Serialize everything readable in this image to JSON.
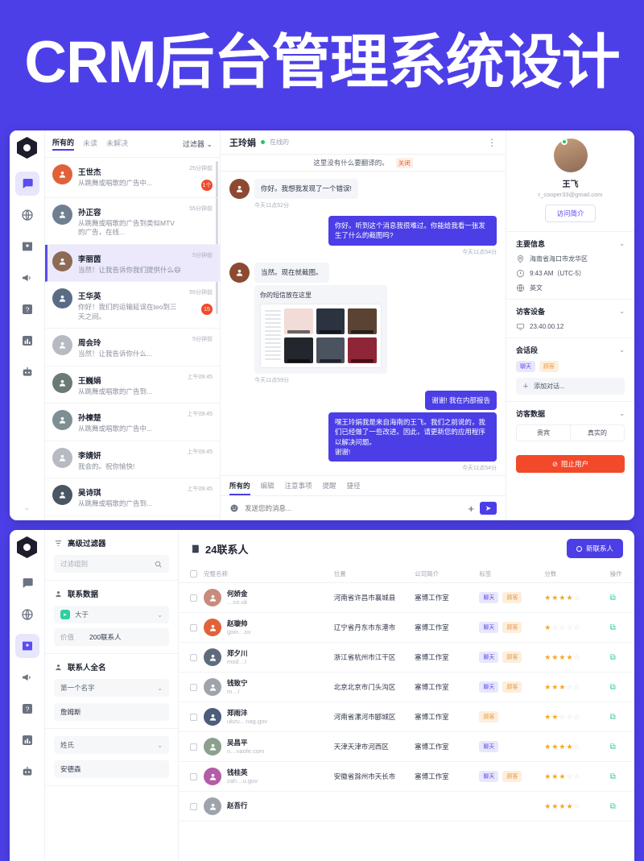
{
  "banner": {
    "title": "CRM后台管理系统设计"
  },
  "colors": {
    "brand": "#4d3fe8",
    "accent": "#4b3ee6",
    "danger": "#f3492b",
    "success": "#2ecfa0",
    "star": "#f5a623"
  },
  "inbox": {
    "rail": [
      {
        "name": "logo",
        "icon": "hexagon-logo"
      },
      {
        "name": "chat",
        "icon": "chat-icon",
        "active": true
      },
      {
        "name": "globe",
        "icon": "globe-icon",
        "active": false
      },
      {
        "name": "contacts",
        "icon": "contact-card-icon",
        "active": false
      },
      {
        "name": "campaign",
        "icon": "megaphone-icon",
        "active": false
      },
      {
        "name": "help",
        "icon": "question-icon",
        "active": false
      },
      {
        "name": "reports",
        "icon": "bar-chart-icon",
        "active": false
      },
      {
        "name": "bot",
        "icon": "robot-icon",
        "active": false
      }
    ],
    "tabs": [
      {
        "label": "所有的",
        "active": true
      },
      {
        "label": "未读",
        "active": false
      },
      {
        "label": "未解决",
        "active": false
      }
    ],
    "filter_label": "过滤器",
    "conversations": [
      {
        "name": "王世杰",
        "snippet": "从跳舞或唱歌的广告中...",
        "time": "25分钟前",
        "badge": "1个",
        "active": false,
        "avatar": "#e0613a"
      },
      {
        "name": "孙正容",
        "snippet": "从跳舞或唱歌的广告到类似MTV的广告，在线...",
        "time": "55分钟前",
        "badge": "",
        "active": false,
        "avatar": "#6f7f91"
      },
      {
        "name": "李丽茵",
        "snippet": "当然！让我告诉你我们提供什么😄",
        "time": "5分钟前",
        "badge": "",
        "active": true,
        "avatar": "#8d6a55"
      },
      {
        "name": "王华英",
        "snippet": "你好！我们的运输延误在teo到三天之间。",
        "time": "55分钟前",
        "badge": "15",
        "active": false,
        "avatar": "#5a6b86"
      },
      {
        "name": "周会玲",
        "snippet": "当然！让我告诉你什么...",
        "time": "5分钟前",
        "badge": "",
        "active": false,
        "avatar": "#b6bac2"
      },
      {
        "name": "王巍娟",
        "snippet": "从跳舞或唱歌的广告到...",
        "time": "上午09:45",
        "badge": "",
        "active": false,
        "avatar": "#6b7b74"
      },
      {
        "name": "孙楝楚",
        "snippet": "从跳舞或唱歌的广告中...",
        "time": "上午09:45",
        "badge": "",
        "active": false,
        "avatar": "#7e8f93"
      },
      {
        "name": "李婧妍",
        "snippet": "我会的。祝你愉快!",
        "time": "上午09:45",
        "badge": "",
        "active": false,
        "avatar": "#b6bac2"
      },
      {
        "name": "吴诗琪",
        "snippet": "从跳舞或唱歌的广告到...",
        "time": "上午09:45",
        "badge": "",
        "active": false,
        "avatar": "#4a5763"
      }
    ],
    "chat": {
      "title": "王玲娟",
      "status": "在线的",
      "notice_text": "这里没有什么要翻译的。",
      "notice_close": "关闭",
      "messages": [
        {
          "dir": "in",
          "text": "你好。我想我发现了一个错误!",
          "time": "今天11点52分"
        },
        {
          "dir": "out",
          "text": "你好。听到这个消息我很难过。你能给我看一张发生了什么的截图吗?",
          "time": "今天11点54分"
        },
        {
          "dir": "in",
          "text": "当然。现在就截图。",
          "time": ""
        }
      ],
      "attachment": {
        "title": "你的短信放在这里",
        "time": "今天11点59分"
      },
      "messages_tail": [
        {
          "dir": "out",
          "text": "谢谢! 我在内部报告",
          "time": ""
        },
        {
          "dir": "out",
          "text": "嘿王玲娟我是来自海南的王飞。我们之前说的，我们已经做了一些改进。因此，请更新您的应用程序以解决问题。\n谢谢!",
          "time": "今天11点54分"
        }
      ],
      "composer_tabs": [
        {
          "label": "所有的",
          "active": true
        },
        {
          "label": "编辑",
          "active": false
        },
        {
          "label": "注意事项",
          "active": false
        },
        {
          "label": "提醒",
          "active": false
        },
        {
          "label": "捷径",
          "active": false
        }
      ],
      "composer_placeholder": "发送您的消息..."
    },
    "profile": {
      "name": "王飞",
      "email": "r_cooper33@gmail.com",
      "cta": "访问简介",
      "sections": [
        {
          "title": "主要信息",
          "rows": [
            {
              "icon": "location-pin-icon",
              "text": "海南省海口市龙华区"
            },
            {
              "icon": "clock-icon",
              "text": "9:43 AM（UTC-5）"
            },
            {
              "icon": "globe-icon",
              "text": "英文"
            }
          ]
        },
        {
          "title": "访客设备",
          "rows": [
            {
              "icon": "monitor-icon",
              "text": "23.40.00.12"
            }
          ]
        }
      ],
      "session_title": "会话段",
      "session_tags": [
        "聊天",
        "顾客"
      ],
      "add_conversation": "添加对话...",
      "visitor_title": "访客数据",
      "visitor_segments": [
        "贵宾",
        "真实的"
      ],
      "block_button": "阻止用户"
    }
  },
  "contacts": {
    "filter": {
      "title": "高级过滤器",
      "search_placeholder": "过滤组别",
      "group_data_title": "联系数据",
      "operator": "大于",
      "value_key": "价值",
      "value": "200联系人",
      "name_title": "联系人全名",
      "first_name_label": "第一个名字",
      "first_name_value": "詹姆斯",
      "last_name_label": "姓氏",
      "last_name_value": "安德森"
    },
    "table": {
      "title": "24联系人",
      "new_button": "新联系人",
      "columns": [
        "完整名称",
        "位置",
        "公司简介",
        "标签",
        "分数",
        "操作"
      ],
      "rows": [
        {
          "name": "何娇金",
          "email": "…co.uk",
          "location": "河南省许昌市襄城县",
          "company": "塞博工作室",
          "tags": [
            "聊天",
            "顾客"
          ],
          "score": 4,
          "avatar": "#c98b7d"
        },
        {
          "name": "赵璇帅",
          "email": "goin…ov",
          "location": "辽宁省丹东市东港市",
          "company": "塞博工作室",
          "tags": [
            "聊天",
            "顾客"
          ],
          "score": 1,
          "avatar": "#e0613a"
        },
        {
          "name": "郑夕川",
          "email": "mod…l",
          "location": "浙江省杭州市江干区",
          "company": "塞博工作室",
          "tags": [
            "聊天",
            "顾客"
          ],
          "score": 4,
          "avatar": "#5e6b7d"
        },
        {
          "name": "钱致宁",
          "email": "m…l",
          "location": "北京北京市门头沟区",
          "company": "塞博工作室",
          "tags": [
            "聊天",
            "顾客"
          ],
          "score": 3,
          "avatar": "#9ea3ac"
        },
        {
          "name": "郑雨沣",
          "email": "ukzu…nag.gov",
          "location": "河南省漯河市郾城区",
          "company": "塞博工作室",
          "tags": [
            "顾客"
          ],
          "score": 2,
          "avatar": "#4c5d7a"
        },
        {
          "name": "吴昌平",
          "email": "n…vaofe.com",
          "location": "天津天津市河西区",
          "company": "塞博工作室",
          "tags": [
            "聊天"
          ],
          "score": 4,
          "avatar": "#8ba08f"
        },
        {
          "name": "钱桂英",
          "email": "zah…u.gov",
          "location": "安徽省滁州市天长市",
          "company": "塞博工作室",
          "tags": [
            "聊天",
            "顾客"
          ],
          "score": 3,
          "avatar": "#b45ca8"
        },
        {
          "name": "赵吾行",
          "email": "",
          "location": "",
          "company": "",
          "tags": [],
          "score": 4,
          "avatar": "#9ea3ac"
        }
      ]
    }
  }
}
